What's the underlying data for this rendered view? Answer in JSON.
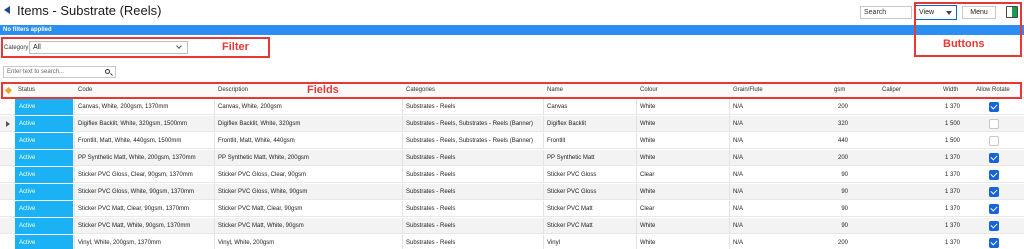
{
  "title": "Items - Substrate (Reels)",
  "toolbar": {
    "search_placeholder": "Search",
    "view_label": "View",
    "menu_label": "Menu"
  },
  "filter_status": "No filters applied",
  "category": {
    "label": "Category",
    "value": "All"
  },
  "text_search_placeholder": "Enter text to search...",
  "annotations": {
    "filter": "Filter",
    "buttons": "Buttons",
    "fields": "Fields"
  },
  "columns": {
    "status": "Status",
    "code": "Code",
    "description": "Description",
    "categories": "Categories",
    "name": "Name",
    "colour": "Colour",
    "grain": "Grain/Flute",
    "gsm": "gsm",
    "caliper": "Caliper",
    "width": "Width",
    "allow_rotate": "Allow Rotate"
  },
  "rows": [
    {
      "status": "Active",
      "code": "Canvas, White, 200gsm, 1370mm",
      "description": "Canvas, White, 200gsm",
      "categories": "Substrates - Reels",
      "name": "Canvas",
      "colour": "White",
      "grain": "N/A",
      "gsm": "200",
      "width": "1 370",
      "allow_rotate": true
    },
    {
      "status": "Active",
      "code": "Digiflex Backlit, White, 320gsm, 1500mm",
      "description": "Digiflex Backlit, White, 320gsm",
      "categories": "Substrates - Reels, Substrates - Reels (Banner)",
      "name": "Digiflex Backlit",
      "colour": "White",
      "grain": "N/A",
      "gsm": "320",
      "width": "1 500",
      "allow_rotate": false
    },
    {
      "status": "Active",
      "code": "Frontlit, Matt, White, 440gsm, 1500mm",
      "description": "Frontlit, Matt, White, 440gsm",
      "categories": "Substrates - Reels, Substrates - Reels (Banner)",
      "name": "Frontlit",
      "colour": "White",
      "grain": "N/A",
      "gsm": "440",
      "width": "1 500",
      "allow_rotate": false
    },
    {
      "status": "Active",
      "code": "PP Synthetic Matt, White, 200gsm, 1370mm",
      "description": "PP Synthetic Matt, White, 200gsm",
      "categories": "Substrates - Reels",
      "name": "PP Synthetic Matt",
      "colour": "White",
      "grain": "N/A",
      "gsm": "200",
      "width": "1 370",
      "allow_rotate": true
    },
    {
      "status": "Active",
      "code": "Sticker PVC Gloss, Clear, 90gsm, 1370mm",
      "description": "Sticker PVC Gloss, Clear, 90gsm",
      "categories": "Substrates - Reels",
      "name": "Sticker PVC Gloss",
      "colour": "Clear",
      "grain": "N/A",
      "gsm": "90",
      "width": "1 370",
      "allow_rotate": true
    },
    {
      "status": "Active",
      "code": "Sticker PVC Gloss, White, 90gsm, 1370mm",
      "description": "Sticker PVC Gloss, White, 90gsm",
      "categories": "Substrates - Reels",
      "name": "Sticker PVC Gloss",
      "colour": "White",
      "grain": "N/A",
      "gsm": "90",
      "width": "1 370",
      "allow_rotate": true
    },
    {
      "status": "Active",
      "code": "Sticker PVC Matt, Clear, 90gsm, 1370mm",
      "description": "Sticker PVC Matt, Clear, 90gsm",
      "categories": "Substrates - Reels",
      "name": "Sticker PVC Matt",
      "colour": "Clear",
      "grain": "N/A",
      "gsm": "90",
      "width": "1 370",
      "allow_rotate": true
    },
    {
      "status": "Active",
      "code": "Sticker PVC Matt, White, 90gsm, 1370mm",
      "description": "Sticker PVC Matt, White, 90gsm",
      "categories": "Substrates - Reels",
      "name": "Sticker PVC Matt",
      "colour": "White",
      "grain": "N/A",
      "gsm": "90",
      "width": "1 370",
      "allow_rotate": true
    },
    {
      "status": "Active",
      "code": "Vinyl, White, 200gsm, 1370mm",
      "description": "Vinyl, White, 200gsm",
      "categories": "Substrates - Reels",
      "name": "Vinyl",
      "colour": "White",
      "grain": "N/A",
      "gsm": "200",
      "width": "1 370",
      "allow_rotate": true
    }
  ],
  "colors": {
    "accent": "#2a8ff0",
    "status_active": "#1ab2f5",
    "annotation": "#e53935",
    "checkbox": "#1565d8"
  }
}
